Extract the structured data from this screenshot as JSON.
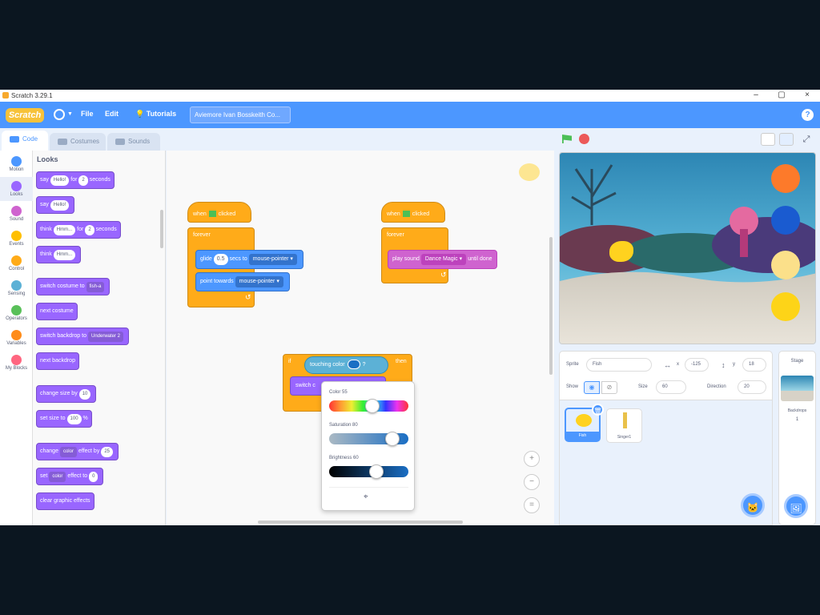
{
  "window": {
    "title": "Scratch 3.29.1",
    "min": "–",
    "max": "▢",
    "close": "×"
  },
  "menubar": {
    "logo": "Scratch",
    "file": "File",
    "edit": "Edit",
    "tutorials": "Tutorials",
    "project_title": "Aviemore Ivan Bosskeith Co..."
  },
  "tabs": [
    {
      "label": "Code"
    },
    {
      "label": "Costumes"
    },
    {
      "label": "Sounds"
    }
  ],
  "categories": [
    {
      "label": "Motion",
      "color": "#4c97ff"
    },
    {
      "label": "Looks",
      "color": "#9966ff"
    },
    {
      "label": "Sound",
      "color": "#cf63cf"
    },
    {
      "label": "Events",
      "color": "#ffbf00"
    },
    {
      "label": "Control",
      "color": "#ffab19"
    },
    {
      "label": "Sensing",
      "color": "#5cb1d6"
    },
    {
      "label": "Operators",
      "color": "#59c059"
    },
    {
      "label": "Variables",
      "color": "#ff8c1a"
    },
    {
      "label": "My Blocks",
      "color": "#ff6680"
    }
  ],
  "palette": {
    "title": "Looks",
    "say_for": {
      "pre": "say",
      "msg": "Hello!",
      "mid": "for",
      "num": "2",
      "post": "seconds"
    },
    "say": {
      "pre": "say",
      "msg": "Hello!"
    },
    "think_for": {
      "pre": "think",
      "msg": "Hmm...",
      "mid": "for",
      "num": "2",
      "post": "seconds"
    },
    "think": {
      "pre": "think",
      "msg": "Hmm..."
    },
    "switch_costume": {
      "pre": "switch costume to",
      "dd": "fish-a"
    },
    "next_costume": "next costume",
    "switch_backdrop": {
      "pre": "switch backdrop to",
      "dd": "Underwater 2"
    },
    "next_backdrop": "next backdrop",
    "change_size": {
      "pre": "change size by",
      "num": "10"
    },
    "set_size": {
      "pre": "set size to",
      "num": "100",
      "post": "%"
    },
    "change_effect": {
      "pre": "change",
      "dd": "color",
      "mid": "effect by",
      "num": "25"
    },
    "set_effect": {
      "pre": "set",
      "dd": "color",
      "mid": "effect to",
      "num": "0"
    },
    "clear_effects": "clear graphic effects"
  },
  "scripts": {
    "s1": {
      "hat_pre": "when",
      "hat_post": "clicked",
      "forever": "forever",
      "glide_pre": "glide",
      "glide_num": "0.5",
      "glide_mid": "secs to",
      "glide_dd": "mouse-pointer",
      "point_pre": "point towards",
      "point_dd": "mouse-pointer"
    },
    "s2": {
      "hat_pre": "when",
      "hat_post": "clicked",
      "forever": "forever",
      "play_pre": "play sound",
      "play_dd": "Dance Magic",
      "play_post": "until done"
    },
    "s3": {
      "if": "if",
      "then": "then",
      "touching": "touching color",
      "q": "?",
      "switch": "switch c"
    }
  },
  "colorpicker": {
    "color_label": "Color",
    "color_val": "55",
    "sat_label": "Saturation",
    "sat_val": "80",
    "bright_label": "Brightness",
    "bright_val": "60",
    "color": 0.55,
    "saturation": 0.8,
    "brightness": 0.6
  },
  "sprite_info": {
    "sprite_label": "Sprite",
    "sprite_name": "Fish",
    "x_label": "x",
    "x": "-125",
    "y_label": "y",
    "y": "18",
    "show_label": "Show",
    "size_label": "Size",
    "size": "60",
    "direction_label": "Direction",
    "direction": "20"
  },
  "sprites": [
    {
      "name": "Fish"
    },
    {
      "name": "Singer1"
    }
  ],
  "stage_panel": {
    "title": "Stage",
    "backdrops_label": "Backdrops",
    "backdrops_count": "1"
  },
  "colors": {
    "accent": "#4c97ff",
    "swatches": [
      "#fd7a2a",
      "#1a5bd0",
      "#fbe08a",
      "#fdd418"
    ]
  }
}
